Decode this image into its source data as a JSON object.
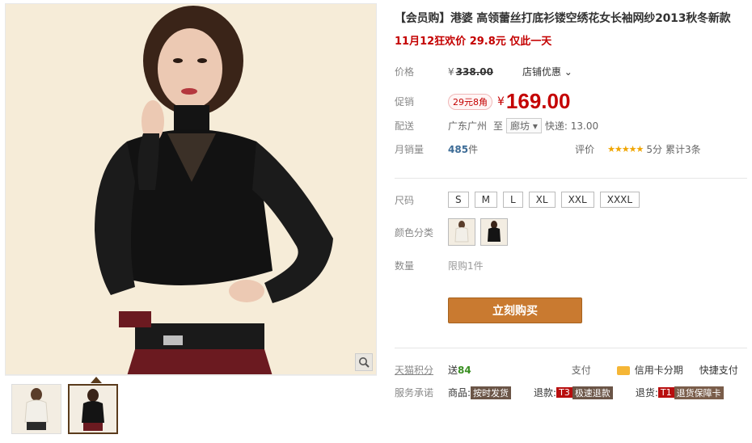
{
  "product": {
    "title": "【会员购】港婆 高领蕾丝打底衫镂空绣花女长袖网纱2013秋冬新款",
    "promo": "11月12狂欢价 29.8元 仅此一天"
  },
  "price": {
    "label": "价格",
    "currency": "¥",
    "original": "338.00",
    "store_promo": "店铺优惠",
    "promo_label": "促销",
    "discount_tag": "29元8角",
    "current": "169.00"
  },
  "shipping": {
    "label": "配送",
    "from": "广东广州",
    "to_word": "至",
    "destination": "廊坊",
    "express": "快递: 13.00"
  },
  "sales": {
    "label": "月销量",
    "count": "485",
    "unit": "件",
    "rating_label": "评价",
    "stars": "★★★★★",
    "score": "5分",
    "total": "累计3条"
  },
  "sizes": {
    "label": "尺码",
    "options": [
      "S",
      "M",
      "L",
      "XL",
      "XXL",
      "XXXL"
    ]
  },
  "colors": {
    "label": "颜色分类"
  },
  "quantity": {
    "label": "数量",
    "limit": "限购1件"
  },
  "buy_button": "立刻购买",
  "points": {
    "label": "天猫积分",
    "value_prefix": "送",
    "value": "84",
    "pay_label": "支付",
    "credit": "信用卡分期",
    "quick_pay": "快捷支付"
  },
  "service": {
    "label": "服务承诺",
    "goods_label": "商品:",
    "goods_tag": "按时发货",
    "refund_label": "退款:",
    "refund_code": "T3",
    "refund_tag": "极速退款",
    "return_label": "退货:",
    "return_code": "T1",
    "return_tag": "退货保障卡"
  },
  "colors_theme": {
    "accent_red": "#c40000",
    "buy_orange": "#c97a30",
    "image_bg": "#f6ecd8"
  }
}
